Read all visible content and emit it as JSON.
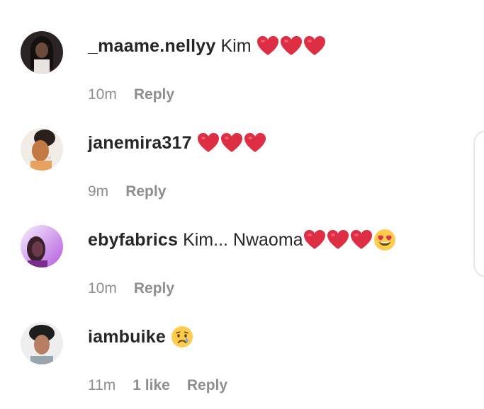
{
  "comments": [
    {
      "username": "_maame.nellyy",
      "text": "Kim",
      "emojis": [
        "red-heart",
        "red-heart",
        "red-heart"
      ],
      "time": "10m",
      "likes": "",
      "reply": "Reply"
    },
    {
      "username": "janemira317",
      "text": "",
      "emojis": [
        "red-heart",
        "red-heart",
        "red-heart"
      ],
      "time": "9m",
      "likes": "",
      "reply": "Reply"
    },
    {
      "username": "ebyfabrics",
      "text": "Kim... Nwaoma",
      "emojis": [
        "red-heart",
        "red-heart",
        "red-heart",
        "heart-eyes-face"
      ],
      "time": "10m",
      "likes": "",
      "reply": "Reply"
    },
    {
      "username": "iambuike",
      "text": "",
      "emojis": [
        "crying-face"
      ],
      "time": "11m",
      "likes": "1 like",
      "reply": "Reply"
    }
  ],
  "colors": {
    "username": "#262626",
    "meta": "#8e8e8e",
    "heart": "#dd2e44"
  }
}
